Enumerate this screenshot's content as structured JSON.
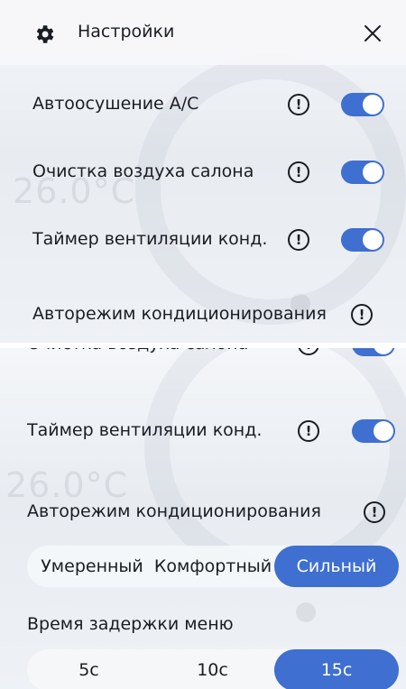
{
  "header": {
    "title": "Настройки",
    "settings_icon": "gear-icon",
    "close_icon": "close-icon"
  },
  "settings": [
    {
      "label": "Автоосушение A/C",
      "enabled": true
    },
    {
      "label": "Очистка воздуха салона",
      "enabled": true
    },
    {
      "label": "Таймер вентиляции конд.",
      "enabled": true
    },
    {
      "label": "Авторежим кондиционирования"
    }
  ],
  "info_glyph": "!",
  "background": {
    "temperature": "26.0°C"
  },
  "auto_mode": {
    "options": [
      "Умеренный",
      "Комфортный",
      "Сильный"
    ],
    "selected": "Сильный"
  },
  "menu_delay": {
    "label": "Время задержки меню",
    "options": [
      "5с",
      "10с",
      "15с"
    ],
    "selected": "15с"
  },
  "colors": {
    "accent": "#3e6fd1",
    "text": "#1a1d22"
  }
}
